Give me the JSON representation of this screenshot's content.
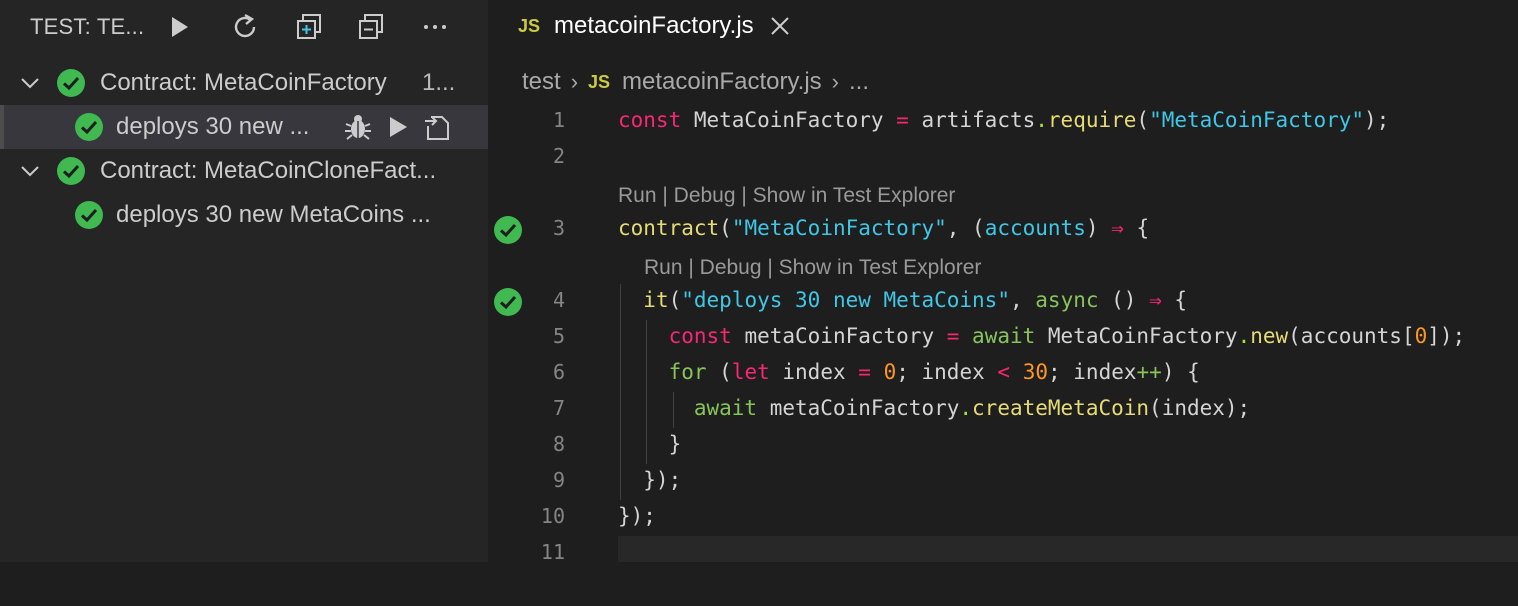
{
  "sidebar": {
    "title": "TEST: TE...",
    "tree": [
      {
        "label": "Contract: MetaCoinFactory",
        "suffix": "1...",
        "level": 0
      },
      {
        "label": "deploys 30 new ...",
        "level": 1,
        "selected": true
      },
      {
        "label": "Contract: MetaCoinCloneFact...",
        "level": 0
      },
      {
        "label": "deploys 30 new MetaCoins  ...",
        "level": 1
      }
    ]
  },
  "editor": {
    "tab": {
      "badge": "JS",
      "filename": "metacoinFactory.js"
    },
    "breadcrumb": {
      "folder": "test",
      "badge": "JS",
      "file": "metacoinFactory.js",
      "tail": "..."
    },
    "codelens_1": "Run | Debug | Show in Test Explorer",
    "codelens_2": "Run | Debug | Show in Test Explorer",
    "line_numbers": [
      "1",
      "2",
      "3",
      "4",
      "5",
      "6",
      "7",
      "8",
      "9",
      "10",
      "11"
    ]
  },
  "colors": {
    "accent_green": "#3fb950",
    "selection": "#37373d",
    "editor_bg": "#1e1e1e",
    "sidebar_bg": "#252526"
  }
}
